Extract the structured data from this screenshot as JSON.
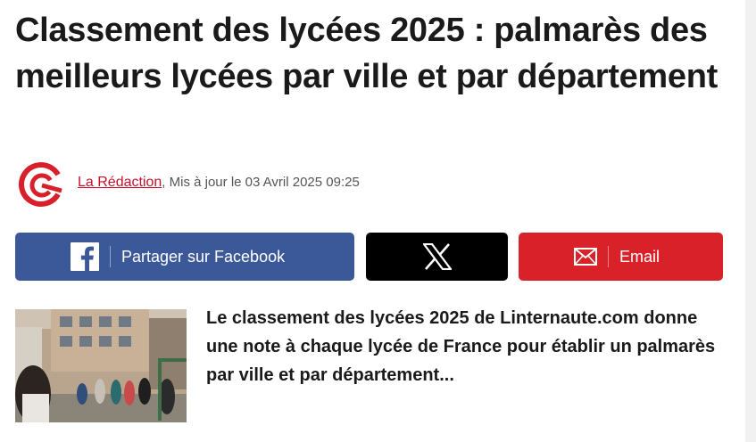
{
  "article": {
    "title": "Classement des lycées 2025 : palmarès des meilleurs lycées par ville et par département",
    "author": "La Rédaction",
    "updated": ", Mis à jour le 03 Avril 2025 09:25",
    "lede": "Le classement des lycées 2025 de Linternaute.com donne une note à chaque lycée de France pour établir un palmarès par ville et par département..."
  },
  "share": {
    "facebook_label": "Partager sur Facebook",
    "email_label": "Email"
  },
  "icons": {
    "brand_logo": "linternaute-logo-icon",
    "facebook": "facebook-icon",
    "x": "x-icon",
    "email": "envelope-icon"
  },
  "colors": {
    "facebook": "#3b5998",
    "x": "#000000",
    "email": "#d82128",
    "brand_red": "#c8102e"
  }
}
